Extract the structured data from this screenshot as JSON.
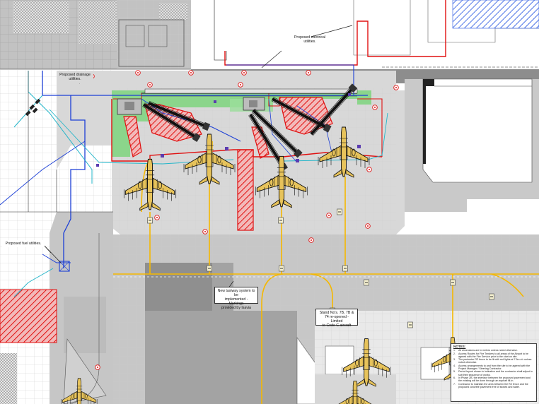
{
  "labels": {
    "electrical": [
      "Proposed electrical",
      "utilities."
    ],
    "drainage": [
      "Proposed drainage",
      "utilities."
    ],
    "fuel": "Proposed fuel utilities.",
    "taxiway": [
      "New taxiway system to be",
      "implemented - Markings",
      "provided by Isavia"
    ],
    "stands": [
      "Stand No's. 7B, 7B &",
      "74 re-opened - Limited",
      "to Code C aircraft"
    ]
  },
  "notes": {
    "title": "NOTES:",
    "items": [
      "All dimensions are in metres unless noted otherwise.",
      "Access Routes for Fire Tenders to all areas of the Airport to be agreed with the Fire Service prior to the start on site.",
      "The perimeter RZ fence to be lit with red lights at 7.5m c/c unless noted otherwise.",
      "Access arrangements to and from the site to be agreed with the Project Manager / Steering Contractor.",
      "Period layout shown is indicative and the contractor shall adjust to suit their sequence of works.",
      "In Phase 2B, the interface between the proposed pavement and the existing will be done through an asphalt fill-in.",
      "Contractor to maintain the area between the RZ fence and the proposed concrete pavement free of stones and water."
    ]
  },
  "colors": {
    "apron": "#d4d4d4",
    "taxiway": "#bdbdbd",
    "dark_pavement": "#9a9a9a",
    "grass": "#7ed57e",
    "hatch_red": "#e01010",
    "hatch_blue": "#2050e0",
    "yellow_line": "#f5b800",
    "utility_blue": "#1c3fd6",
    "utility_cyan": "#23b5c9",
    "aircraft_body": "#e7c35b",
    "outline": "#111111"
  }
}
